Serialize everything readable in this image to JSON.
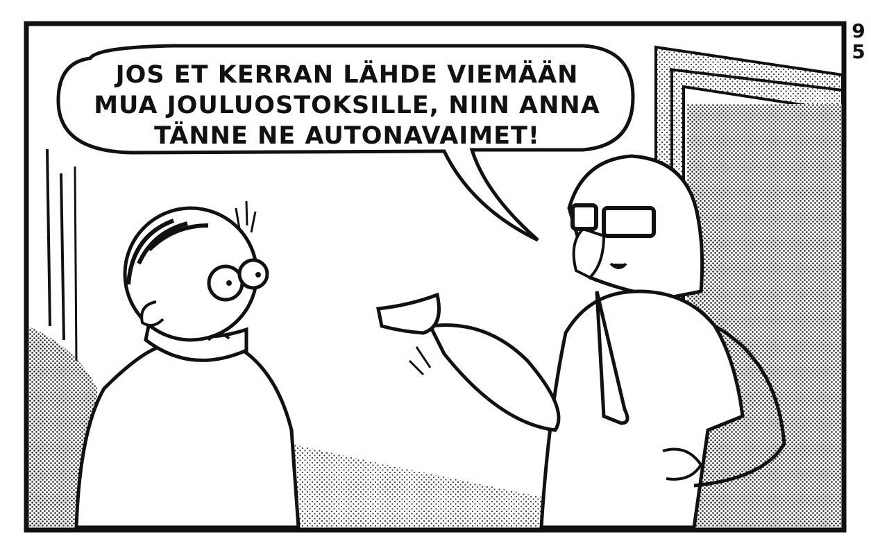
{
  "speech_bubble": {
    "lines": [
      "JOS ET KERRAN LÄHDE VIEMÄÄN",
      "MUA JOULUOSTOKSILLE, NIIN ANNA",
      "TÄNNE NE AUTONAVAIMET!"
    ]
  },
  "page_number": {
    "digits": [
      "9",
      "5"
    ]
  },
  "colors": {
    "ink": "#111111",
    "paper": "#ffffff",
    "screen_tone": "#9a9a9a"
  }
}
